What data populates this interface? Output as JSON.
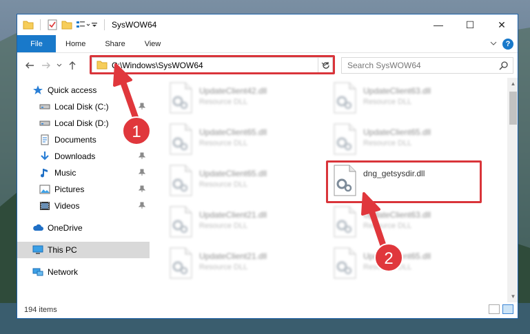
{
  "window": {
    "title": "SysWOW64",
    "minimize": "—",
    "maximize": "☐",
    "close": "✕"
  },
  "ribbon": {
    "tabs": [
      "File",
      "Home",
      "Share",
      "View"
    ],
    "help": "?"
  },
  "nav": {
    "address": "C:\\Windows\\SysWOW64",
    "search_placeholder": "Search SysWOW64"
  },
  "sidebar": {
    "quick_access": "Quick access",
    "items": [
      {
        "label": "Local Disk (C:)",
        "icon": "drive-icon",
        "pinned": true
      },
      {
        "label": "Local Disk (D:)",
        "icon": "drive-icon",
        "pinned": false
      },
      {
        "label": "Documents",
        "icon": "documents-icon",
        "pinned": true
      },
      {
        "label": "Downloads",
        "icon": "download-icon",
        "pinned": true
      },
      {
        "label": "Music",
        "icon": "music-icon",
        "pinned": true
      },
      {
        "label": "Pictures",
        "icon": "pictures-icon",
        "pinned": true
      },
      {
        "label": "Videos",
        "icon": "videos-icon",
        "pinned": true
      }
    ],
    "onedrive": "OneDrive",
    "this_pc": "This PC",
    "network": "Network"
  },
  "files": [
    {
      "name": "UpdateClient42.dll",
      "type": "Resource DLL",
      "col": 0,
      "row": 0,
      "blurred": true
    },
    {
      "name": "UpdateClient63.dll",
      "type": "Resource DLL",
      "col": 1,
      "row": 0,
      "blurred": true
    },
    {
      "name": "UpdateClient65.dll",
      "type": "Resource DLL",
      "col": 0,
      "row": 1,
      "blurred": true
    },
    {
      "name": "UpdateClient65.dll",
      "type": "Resource DLL",
      "col": 1,
      "row": 1,
      "blurred": true
    },
    {
      "name": "UpdateClient65.dll",
      "type": "Resource DLL",
      "col": 0,
      "row": 2,
      "blurred": true
    },
    {
      "name": "dng_getsysdir.dll",
      "type": "",
      "col": 1,
      "row": 2,
      "blurred": false
    },
    {
      "name": "UpdateClient21.dll",
      "type": "Resource DLL",
      "col": 0,
      "row": 3,
      "blurred": true
    },
    {
      "name": "UpdateClient63.dll",
      "type": "Resource DLL",
      "col": 1,
      "row": 3,
      "blurred": true
    },
    {
      "name": "UpdateClient21.dll",
      "type": "Resource DLL",
      "col": 0,
      "row": 4,
      "blurred": true
    },
    {
      "name": "UpdateClient65.dll",
      "type": "Resource DLL",
      "col": 1,
      "row": 4,
      "blurred": true
    }
  ],
  "status": {
    "count": "194 items"
  },
  "annotations": {
    "step1": "1",
    "step2": "2",
    "color": "#e0373c"
  }
}
